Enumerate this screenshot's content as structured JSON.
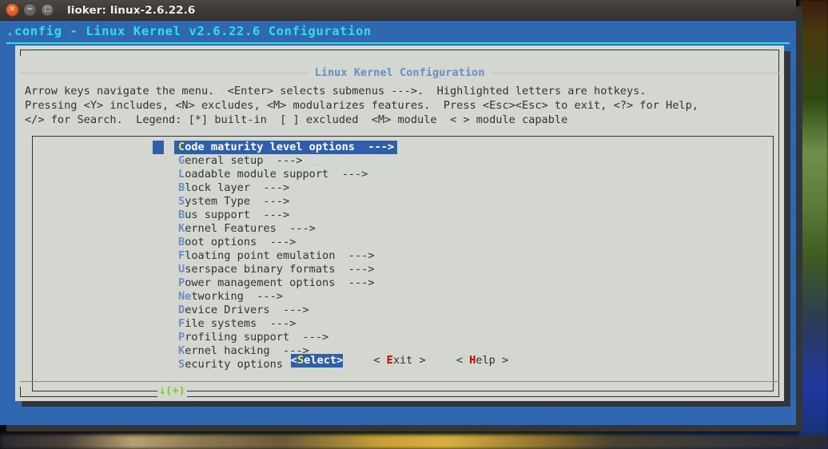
{
  "window": {
    "title": "lioker: linux-2.6.22.6",
    "controls": [
      {
        "name": "close",
        "glyph": "✕"
      },
      {
        "name": "minimize",
        "glyph": "−"
      },
      {
        "name": "maximize",
        "glyph": "□"
      }
    ]
  },
  "terminal": {
    "menubar": ".config - Linux Kernel v2.6.22.6 Configuration",
    "bg_color": "#2f67b0",
    "accent_color": "#2ee0e6"
  },
  "dialog": {
    "title": "Linux Kernel Configuration",
    "title_color": "#6a8fc7",
    "bg_color": "#d3d7cf",
    "help_lines": [
      "Arrow keys navigate the menu.  <Enter> selects submenus --->.  Highlighted letters are hotkeys.",
      "Pressing <Y> includes, <N> excludes, <M> modularizes features.  Press <Esc><Esc> to exit, <?> for Help,",
      "</> for Search.  Legend: [*] built-in  [ ] excluded  <M> module  < > module capable"
    ],
    "more_indicator": "↓(+)",
    "more_indicator_color": "#73d216",
    "selection_color": "#2f5fa8",
    "hotkey_color": "#6a8fc7",
    "selected_hotkey_color": "#fce94f"
  },
  "menu": {
    "selected_index": 0,
    "items": [
      {
        "hot": "C",
        "rest": "ode maturity level options  --->"
      },
      {
        "hot": "G",
        "rest": "eneral setup  --->"
      },
      {
        "hot": "L",
        "rest": "oadable module support  --->"
      },
      {
        "hot": "B",
        "rest": "lock layer  --->"
      },
      {
        "hot": "S",
        "rest": "ystem Type  --->"
      },
      {
        "hot": "B",
        "rest": "us support  --->"
      },
      {
        "hot": "K",
        "rest": "ernel Features  --->"
      },
      {
        "hot": "B",
        "rest": "oot options  --->"
      },
      {
        "hot": "F",
        "rest": "loating point emulation  --->"
      },
      {
        "hot": "U",
        "rest": "serspace binary formats  --->"
      },
      {
        "hot": "P",
        "rest": "ower management options  --->"
      },
      {
        "hot": "Ne",
        "rest": "tworking  --->"
      },
      {
        "hot": "D",
        "rest": "evice Drivers  --->"
      },
      {
        "hot": "F",
        "rest": "ile systems  --->"
      },
      {
        "hot": "P",
        "rest": "rofiling support  --->"
      },
      {
        "hot": "K",
        "rest": "ernel hacking  --->"
      },
      {
        "hot": "S",
        "rest": "ecurity options  --->"
      }
    ]
  },
  "buttons": [
    {
      "name": "select",
      "pre": "<",
      "hot": "S",
      "rest": "elect>",
      "primary": true
    },
    {
      "name": "exit",
      "pre": "< ",
      "hot": "E",
      "rest": "xit >",
      "primary": false
    },
    {
      "name": "help",
      "pre": "< ",
      "hot": "H",
      "rest": "elp >",
      "primary": false
    }
  ]
}
